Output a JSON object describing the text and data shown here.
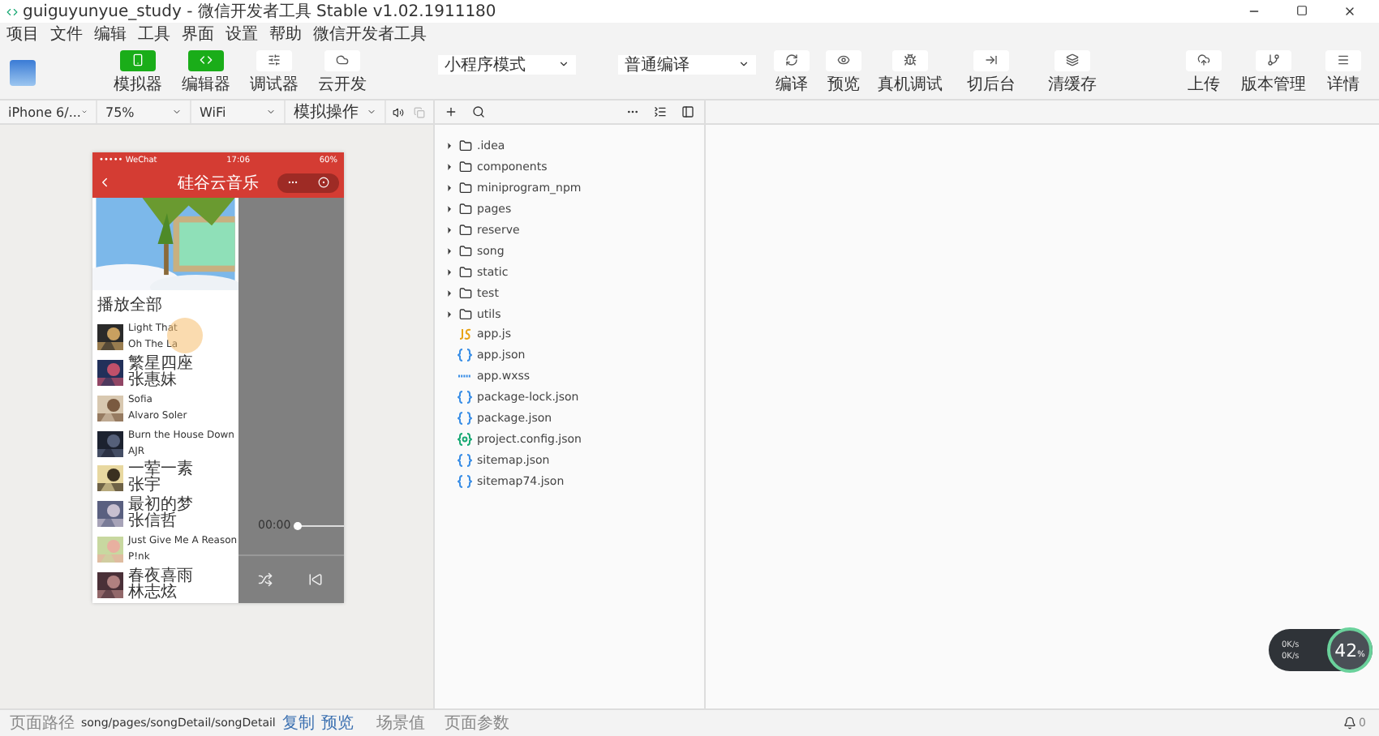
{
  "window": {
    "title": "guiguyunyue_study - 微信开发者工具 Stable v1.02.1911180"
  },
  "menu": [
    "项目",
    "文件",
    "编辑",
    "工具",
    "界面",
    "设置",
    "帮助",
    "微信开发者工具"
  ],
  "toolbar": {
    "view_buttons": [
      {
        "label": "模拟器",
        "selected": true
      },
      {
        "label": "编辑器",
        "selected": true
      },
      {
        "label": "调试器",
        "selected": false
      },
      {
        "label": "云开发",
        "selected": false
      }
    ],
    "mode_select": "小程序模式",
    "compile_select": "普通编译",
    "action_buttons": [
      {
        "label": "编译",
        "kind": "compile"
      },
      {
        "label": "预览",
        "kind": "preview"
      },
      {
        "label": "真机调试",
        "kind": "debug"
      },
      {
        "label": "切后台",
        "kind": "background"
      },
      {
        "label": "清缓存",
        "kind": "cache"
      }
    ],
    "right_buttons": [
      {
        "label": "上传",
        "kind": "upload"
      },
      {
        "label": "版本管理",
        "kind": "version"
      },
      {
        "label": "详情",
        "kind": "details"
      }
    ]
  },
  "simulator_toolbar": {
    "device": "iPhone 6/...",
    "zoom": "75%",
    "network": "WiFi",
    "operation": "模拟操作"
  },
  "phone": {
    "carrier": "••••• WeChat",
    "time": "17:06",
    "battery": "60%",
    "nav_title": "硅谷云音乐",
    "section_title": "播放全部",
    "songs": [
      {
        "title": "Light That",
        "artist": "Oh The La"
      },
      {
        "title": "繁星四座",
        "artist": "张惠妹"
      },
      {
        "title": "Sofia",
        "artist": "Alvaro Soler"
      },
      {
        "title": "Burn the House Down",
        "artist": "AJR"
      },
      {
        "title": "一荤一素",
        "artist": "张宇"
      },
      {
        "title": "最初的梦",
        "artist": "张信哲"
      },
      {
        "title": "Just Give Me A Reason",
        "artist": "P!nk"
      },
      {
        "title": "春夜喜雨",
        "artist": "林志炫"
      }
    ],
    "player": {
      "time": "00:00",
      "level": 0
    }
  },
  "file_tree": [
    {
      "name": ".idea",
      "kind": "folder"
    },
    {
      "name": "components",
      "kind": "folder"
    },
    {
      "name": "miniprogram_npm",
      "kind": "folder"
    },
    {
      "name": "pages",
      "kind": "folder"
    },
    {
      "name": "reserve",
      "kind": "folder"
    },
    {
      "name": "song",
      "kind": "folder"
    },
    {
      "name": "static",
      "kind": "folder"
    },
    {
      "name": "test",
      "kind": "folder"
    },
    {
      "name": "utils",
      "kind": "folder"
    },
    {
      "name": "app.js",
      "kind": "js"
    },
    {
      "name": "app.json",
      "kind": "json"
    },
    {
      "name": "app.wxss",
      "kind": "wxss"
    },
    {
      "name": "package-lock.json",
      "kind": "json"
    },
    {
      "name": "package.json",
      "kind": "json"
    },
    {
      "name": "project.config.json",
      "kind": "config"
    },
    {
      "name": "sitemap.json",
      "kind": "json"
    },
    {
      "name": "sitemap74.json",
      "kind": "json"
    }
  ],
  "network_widget": {
    "upload": "0K/s",
    "download": "0K/s",
    "percent": "42",
    "percent_unit": "%"
  },
  "status_bar": {
    "path_label": "页面路径",
    "path": "song/pages/songDetail/songDetail",
    "copy": "复制",
    "preview": "预览",
    "scene": "场景值",
    "params": "页面参数",
    "notifications": "0"
  }
}
